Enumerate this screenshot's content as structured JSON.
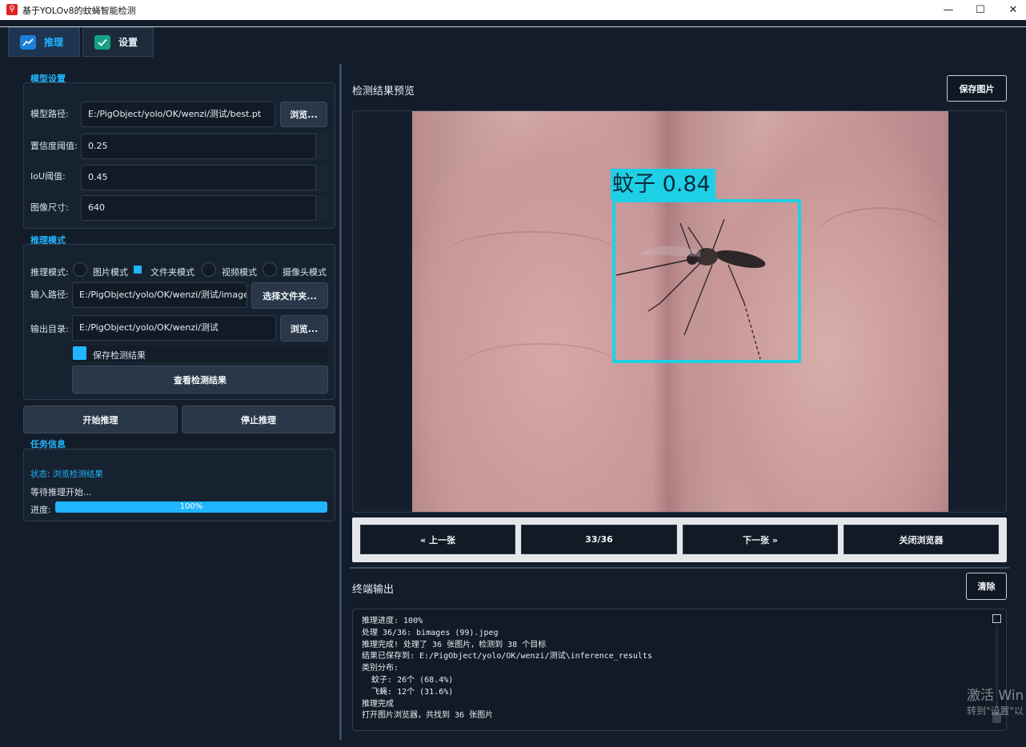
{
  "window": {
    "title": "基于YOLOv8的蚊蝇智能检测",
    "icon": "app-logo-icon",
    "controls": [
      "minimize-icon",
      "maximize-icon",
      "close-icon"
    ]
  },
  "tabs": [
    {
      "label": "推理",
      "icon": "chart-icon",
      "active": true
    },
    {
      "label": "设置",
      "icon": "check-icon",
      "active": false
    }
  ],
  "model_settings": {
    "header": "模型设置",
    "model_path_label": "模型路径:",
    "model_path_value": "E:/PigObject/yolo/OK/wenzi/测试/best.pt",
    "browse_label": "浏览...",
    "confidence_label": "置信度阈值:",
    "confidence_value": "0.25",
    "iou_label": "IoU阈值:",
    "iou_value": "0.45",
    "image_size_label": "图像尺寸:",
    "image_size_value": "640"
  },
  "inference_mode": {
    "header": "推理模式",
    "mode_label": "推理模式:",
    "modes": [
      {
        "label": "图片模式",
        "checked": false
      },
      {
        "label": "文件夹模式",
        "checked": true
      },
      {
        "label": "视频模式",
        "checked": false
      },
      {
        "label": "摄像头模式",
        "checked": false
      }
    ],
    "input_path_label": "输入路径:",
    "input_path_value": "E:/PigObject/yolo/OK/wenzi/测试/image",
    "select_folder_label": "选择文件夹...",
    "output_dir_label": "输出目录:",
    "output_dir_value": "E:/PigObject/yolo/OK/wenzi/测试",
    "output_browse_label": "浏览...",
    "save_results_label": "保存检测结果",
    "save_results_checked": true,
    "view_results_label": "查看检测结果"
  },
  "actions": {
    "start_label": "开始推理",
    "stop_label": "停止推理"
  },
  "task_info": {
    "header": "任务信息",
    "status_text": "状态: 浏览检测结果",
    "waiting_text": "等待推理开始...",
    "progress_label": "进度:",
    "progress_value": 1.0,
    "progress_text": "100%"
  },
  "preview": {
    "title": "检测结果预览",
    "save_image_label": "保存图片",
    "detection_label": "蚊子 0.84",
    "nav": {
      "prev_label": "« 上一张",
      "counter": "33/36",
      "next_label": "下一张 »",
      "close_label": "关闭浏览器"
    }
  },
  "terminal": {
    "title": "终端输出",
    "clear_label": "清除",
    "lines": [
      "推理进度: 100%",
      "处理 36/36: bimages (99).jpeg",
      "推理完成! 处理了 36 张图片，检测到 38 个目标",
      "结果已保存到: E:/PigObject/yolo/OK/wenzi/测试\\inference_results",
      "类别分布:",
      "  蚊子: 26个 (68.4%)",
      "  飞蝇: 12个 (31.6%)",
      "推理完成",
      "打开图片浏览器，共找到 36 张图片"
    ]
  },
  "watermark": {
    "line1": "激活 Win",
    "line2": "转到\"设置\"以"
  },
  "colors": {
    "accent": "#1fb6ff",
    "background": "#131c29",
    "detection_box": "#1ed0e6"
  }
}
